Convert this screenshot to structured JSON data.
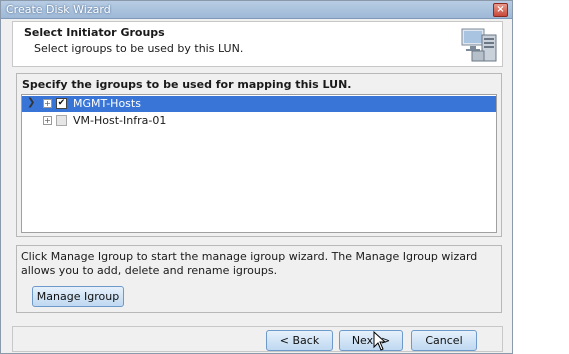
{
  "window": {
    "title": "Create Disk Wizard",
    "close_glyph": "×"
  },
  "header": {
    "title": "Select Initiator Groups",
    "subtitle": "Select igroups to be used by this LUN.",
    "icon": "wizard-server-icon"
  },
  "igroups": {
    "label": "Specify the igroups to be used for mapping this LUN.",
    "items": [
      {
        "name": "MGMT-Hosts",
        "checked": true,
        "selected": true
      },
      {
        "name": "VM-Host-Infra-01",
        "checked": false,
        "selected": false
      }
    ]
  },
  "info": {
    "text": "Click Manage Igroup to start the manage igroup wizard. The Manage Igroup wizard allows you to add, delete and rename igroups.",
    "manage_button": "Manage Igroup"
  },
  "footer": {
    "back": "< Back",
    "next": "Next >",
    "cancel": "Cancel"
  },
  "colors": {
    "selection": "#3875d7",
    "titlebar": "#9eb8d6"
  }
}
